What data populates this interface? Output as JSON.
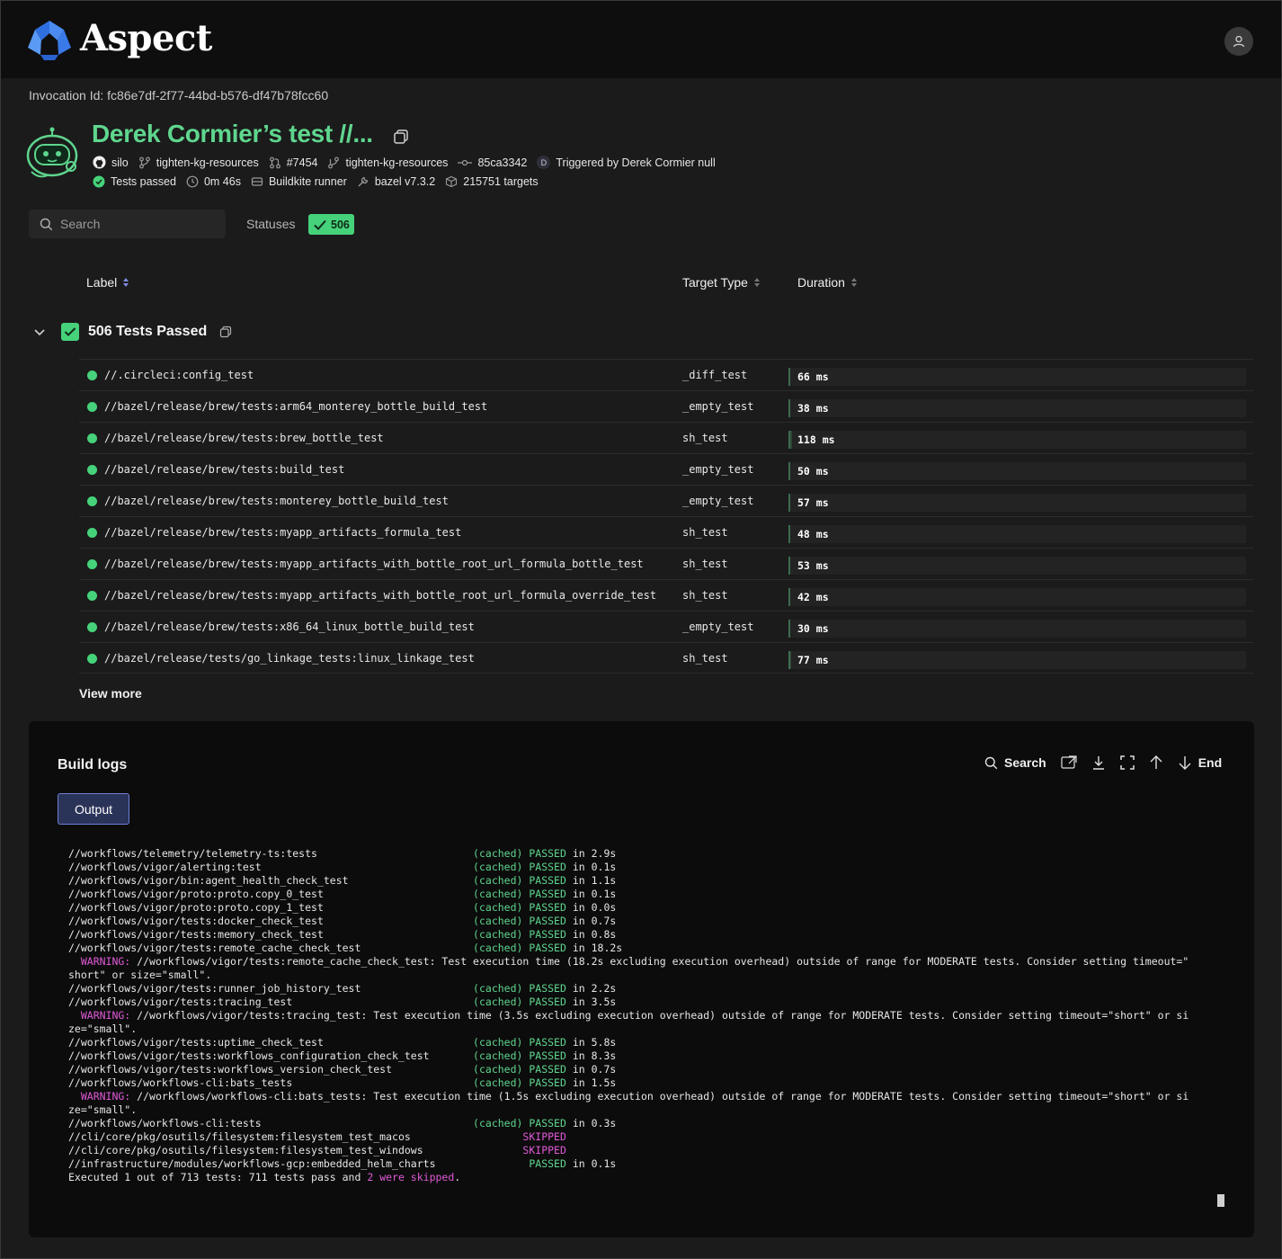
{
  "brand": {
    "name": "Aspect"
  },
  "invocation": "Invocation Id: fc86e7df-2f77-44bd-b576-df47b78fcc60",
  "title": "Derek Cormier’s test //...",
  "meta": {
    "repo": "silo",
    "branch": "tighten-kg-resources",
    "pr": "#7454",
    "pr_branch": "tighten-kg-resources",
    "commit": "85ca3342",
    "trigger_initial": "D",
    "triggered_by": "Triggered by Derek Cormier null",
    "status": "Tests passed",
    "duration": "0m 46s",
    "runner": "Buildkite runner",
    "bazel": "bazel v7.3.2",
    "targets": "215751 targets"
  },
  "search": {
    "placeholder": "Search"
  },
  "statuses": {
    "label": "Statuses",
    "count": "506"
  },
  "table": {
    "headers": {
      "label": "Label",
      "target_type": "Target Type",
      "duration": "Duration"
    },
    "group_label": "506 Tests Passed",
    "rows": [
      {
        "label": "//.circleci:config_test",
        "type": "_diff_test",
        "duration": "66 ms",
        "ms": 66
      },
      {
        "label": "//bazel/release/brew/tests:arm64_monterey_bottle_build_test",
        "type": "_empty_test",
        "duration": "38 ms",
        "ms": 38
      },
      {
        "label": "//bazel/release/brew/tests:brew_bottle_test",
        "type": "sh_test",
        "duration": "118 ms",
        "ms": 118
      },
      {
        "label": "//bazel/release/brew/tests:build_test",
        "type": "_empty_test",
        "duration": "50 ms",
        "ms": 50
      },
      {
        "label": "//bazel/release/brew/tests:monterey_bottle_build_test",
        "type": "_empty_test",
        "duration": "57 ms",
        "ms": 57
      },
      {
        "label": "//bazel/release/brew/tests:myapp_artifacts_formula_test",
        "type": "sh_test",
        "duration": "48 ms",
        "ms": 48
      },
      {
        "label": "//bazel/release/brew/tests:myapp_artifacts_with_bottle_root_url_formula_bottle_test",
        "type": "sh_test",
        "duration": "53 ms",
        "ms": 53
      },
      {
        "label": "//bazel/release/brew/tests:myapp_artifacts_with_bottle_root_url_formula_override_test",
        "type": "sh_test",
        "duration": "42 ms",
        "ms": 42
      },
      {
        "label": "//bazel/release/brew/tests:x86_64_linux_bottle_build_test",
        "type": "_empty_test",
        "duration": "30 ms",
        "ms": 30
      },
      {
        "label": "//bazel/release/tests/go_linkage_tests:linux_linkage_test",
        "type": "sh_test",
        "duration": "77 ms",
        "ms": 77
      }
    ],
    "view_more": "View more"
  },
  "logs": {
    "title": "Build logs",
    "tools": {
      "search": "Search",
      "end": "End"
    },
    "tab": "Output",
    "lines": [
      {
        "t": "//workflows/telemetry/telemetry-ts:tests                         ",
        "s": "(cached) PASSED",
        "r": " in 2.9s"
      },
      {
        "t": "//workflows/vigor/alerting:test                                  ",
        "s": "(cached) PASSED",
        "r": " in 0.1s"
      },
      {
        "t": "//workflows/vigor/bin:agent_health_check_test                    ",
        "s": "(cached) PASSED",
        "r": " in 1.1s"
      },
      {
        "t": "//workflows/vigor/proto:proto.copy_0_test                        ",
        "s": "(cached) PASSED",
        "r": " in 0.1s"
      },
      {
        "t": "//workflows/vigor/proto:proto.copy_1_test                        ",
        "s": "(cached) PASSED",
        "r": " in 0.0s"
      },
      {
        "t": "//workflows/vigor/tests:docker_check_test                        ",
        "s": "(cached) PASSED",
        "r": " in 0.7s"
      },
      {
        "t": "//workflows/vigor/tests:memory_check_test                        ",
        "s": "(cached) PASSED",
        "r": " in 0.8s"
      },
      {
        "t": "//workflows/vigor/tests:remote_cache_check_test                  ",
        "s": "(cached) PASSED",
        "r": " in 18.2s"
      },
      {
        "w": "  WARNING:",
        "t": " //workflows/vigor/tests:remote_cache_check_test: Test execution time (18.2s excluding execution overhead) outside of range for MODERATE tests. Consider setting timeout=\""
      },
      {
        "t": "short\" or size=\"small\"."
      },
      {
        "t": "//workflows/vigor/tests:runner_job_history_test                  ",
        "s": "(cached) PASSED",
        "r": " in 2.2s"
      },
      {
        "t": "//workflows/vigor/tests:tracing_test                             ",
        "s": "(cached) PASSED",
        "r": " in 3.5s"
      },
      {
        "w": "  WARNING:",
        "t": " //workflows/vigor/tests:tracing_test: Test execution time (3.5s excluding execution overhead) outside of range for MODERATE tests. Consider setting timeout=\"short\" or si"
      },
      {
        "t": "ze=\"small\"."
      },
      {
        "t": "//workflows/vigor/tests:uptime_check_test                        ",
        "s": "(cached) PASSED",
        "r": " in 5.8s"
      },
      {
        "t": "//workflows/vigor/tests:workflows_configuration_check_test       ",
        "s": "(cached) PASSED",
        "r": " in 8.3s"
      },
      {
        "t": "//workflows/vigor/tests:workflows_version_check_test             ",
        "s": "(cached) PASSED",
        "r": " in 0.7s"
      },
      {
        "t": "//workflows/workflows-cli:bats_tests                             ",
        "s": "(cached) PASSED",
        "r": " in 1.5s"
      },
      {
        "w": "  WARNING:",
        "t": " //workflows/workflows-cli:bats_tests: Test execution time (1.5s excluding execution overhead) outside of range for MODERATE tests. Consider setting timeout=\"short\" or si"
      },
      {
        "t": "ze=\"small\"."
      },
      {
        "t": "//workflows/workflows-cli:tests                                  ",
        "s": "(cached) PASSED",
        "r": " in 0.3s"
      },
      {
        "t": "//cli/core/pkg/osutils/filesystem:filesystem_test_macos                  ",
        "m": "SKIPPED"
      },
      {
        "t": "//cli/core/pkg/osutils/filesystem:filesystem_test_windows                ",
        "m": "SKIPPED"
      },
      {
        "t": "//infrastructure/modules/workflows-gcp:embedded_helm_charts               ",
        "s": "PASSED",
        "r": " in 0.1s"
      },
      {
        "t": ""
      },
      {
        "t": "Executed 1 out of 713 tests: 711 tests pass and ",
        "m": "2 were skipped",
        "r": "."
      }
    ]
  },
  "colors": {
    "accent_green": "#46d27a",
    "title_green": "#5fd68e",
    "skipped_magenta": "#e05ad8",
    "tab_blue": "#6f7fd6"
  },
  "icons": [
    "aspect-logo-icon",
    "user-icon",
    "copy-icon",
    "github-icon",
    "branch-icon",
    "pull-request-icon",
    "commit-icon",
    "check-circle-icon",
    "clock-icon",
    "runner-icon",
    "wrench-icon",
    "package-icon",
    "search-icon",
    "check-icon",
    "sort-icon",
    "chevron-down-icon",
    "raw-icon",
    "download-icon",
    "fullscreen-icon",
    "arrow-up-icon",
    "arrow-down-icon"
  ]
}
